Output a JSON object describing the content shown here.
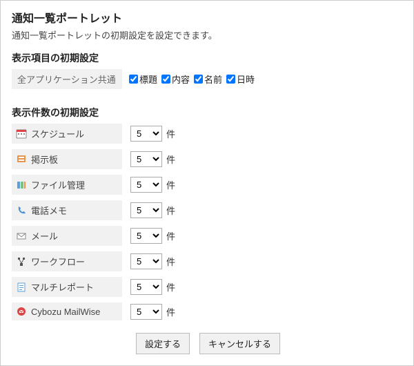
{
  "title": "通知一覧ポートレット",
  "description": "通知一覧ポートレットの初期設定を設定できます。",
  "columns_section": {
    "heading": "表示項目の初期設定",
    "row_label": "全アプリケーション共通",
    "options": [
      {
        "label": "標題",
        "checked": true
      },
      {
        "label": "内容",
        "checked": true
      },
      {
        "label": "名前",
        "checked": true
      },
      {
        "label": "日時",
        "checked": true
      }
    ]
  },
  "count_section": {
    "heading": "表示件数の初期設定",
    "unit": "件",
    "rows": [
      {
        "label": "スケジュール",
        "value": "5",
        "icon": "calendar"
      },
      {
        "label": "掲示板",
        "value": "5",
        "icon": "board"
      },
      {
        "label": "ファイル管理",
        "value": "5",
        "icon": "file"
      },
      {
        "label": "電話メモ",
        "value": "5",
        "icon": "phone"
      },
      {
        "label": "メール",
        "value": "5",
        "icon": "mail"
      },
      {
        "label": "ワークフロー",
        "value": "5",
        "icon": "workflow"
      },
      {
        "label": "マルチレポート",
        "value": "5",
        "icon": "report"
      },
      {
        "label": "Cybozu MailWise",
        "value": "5",
        "icon": "mailwise"
      }
    ]
  },
  "buttons": {
    "submit": "設定する",
    "cancel": "キャンセルする"
  }
}
